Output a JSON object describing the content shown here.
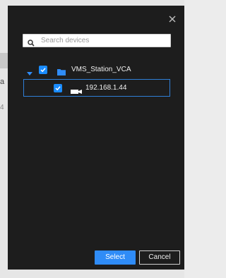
{
  "search": {
    "placeholder": "Search devices",
    "value": ""
  },
  "tree": {
    "root": {
      "label": "VMS_Station_VCA",
      "checked": true,
      "expanded": true
    },
    "children": [
      {
        "label": "192.168.1.44",
        "checked": true,
        "selected": true
      }
    ]
  },
  "buttons": {
    "select_label": "Select",
    "cancel_label": "Cancel"
  },
  "background": {
    "partial_text": "a",
    "partial_text2": "4"
  },
  "icons": {
    "close": "close-icon",
    "search": "search-icon",
    "caret": "caret-down-icon",
    "folder": "folder-icon",
    "camera": "camera-icon",
    "check": "check-icon"
  },
  "colors": {
    "dialog_bg": "#1d1d1d",
    "accent": "#1a8cff",
    "select_button": "#2f8cf7",
    "selected_border": "#2f7fd8"
  }
}
